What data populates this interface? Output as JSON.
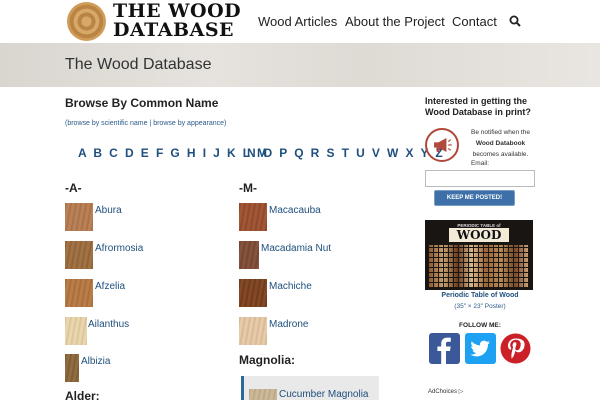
{
  "logo": {
    "line1": "THE WOOD",
    "line2": "DATABASE"
  },
  "nav": {
    "articles": "Wood Articles",
    "about": "About the Project",
    "contact": "Contact"
  },
  "page": {
    "title": "The Wood Database"
  },
  "browse": {
    "title": "Browse By Common Name",
    "scientific_link": "(browse by scientific name",
    "separator": " | ",
    "appearance_link": "browse by appearance)",
    "letters_a_m": [
      "A",
      "B",
      "C",
      "D",
      "E",
      "F",
      "G",
      "H",
      "I",
      "J",
      "K",
      "L",
      "M"
    ],
    "letters_n_z": [
      "N",
      "O",
      "P",
      "Q",
      "R",
      "S",
      "T",
      "U",
      "V",
      "W",
      "X",
      "Y",
      "Z"
    ]
  },
  "groups": {
    "a": {
      "heading": "-A-",
      "items": [
        {
          "name": "Abura",
          "color": "#b67a4e"
        },
        {
          "name": "Afrormosia",
          "color": "#9c6a3a"
        },
        {
          "name": "Afzelia",
          "color": "#b57640"
        },
        {
          "name": "Ailanthus",
          "color": "#e9d3a8"
        },
        {
          "name": "Albizia",
          "color": "#8a6438"
        }
      ]
    },
    "alder": {
      "heading": "Alder:"
    },
    "m": {
      "heading": "-M-",
      "items": [
        {
          "name": "Macacauba",
          "color": "#9b4e2c"
        },
        {
          "name": "Macadamia Nut",
          "color": "#7e4a34"
        },
        {
          "name": "Machiche",
          "color": "#7a3f1c"
        },
        {
          "name": "Madrone",
          "color": "#e6c7a2"
        }
      ]
    },
    "magnolia": {
      "heading": "Magnolia:",
      "items": [
        {
          "name": "Cucumber Magnolia",
          "color": "#c9b493"
        }
      ]
    }
  },
  "sidebar": {
    "title": "Interested in getting the Wood Database in print?",
    "note_before": "Be notified when the",
    "note_bold": "Wood Databook",
    "note_after": "becomes available.",
    "email_label": "Email:",
    "email_value": "",
    "keep_button": "KEEP ME POSTED!",
    "poster_top": "PERIODIC TABLE of",
    "poster_word": "WOOD",
    "poster_caption": "Periodic Table of Wood",
    "poster_size": "(35\" × 23\" Poster)",
    "follow": "FOLLOW ME:",
    "adchoices": "AdChoices"
  },
  "colors": {
    "link": "#1f4f7d",
    "facebook": "#3b5998",
    "twitter": "#1da1f2",
    "pinterest": "#cb2027",
    "button": "#3d6fa8"
  }
}
